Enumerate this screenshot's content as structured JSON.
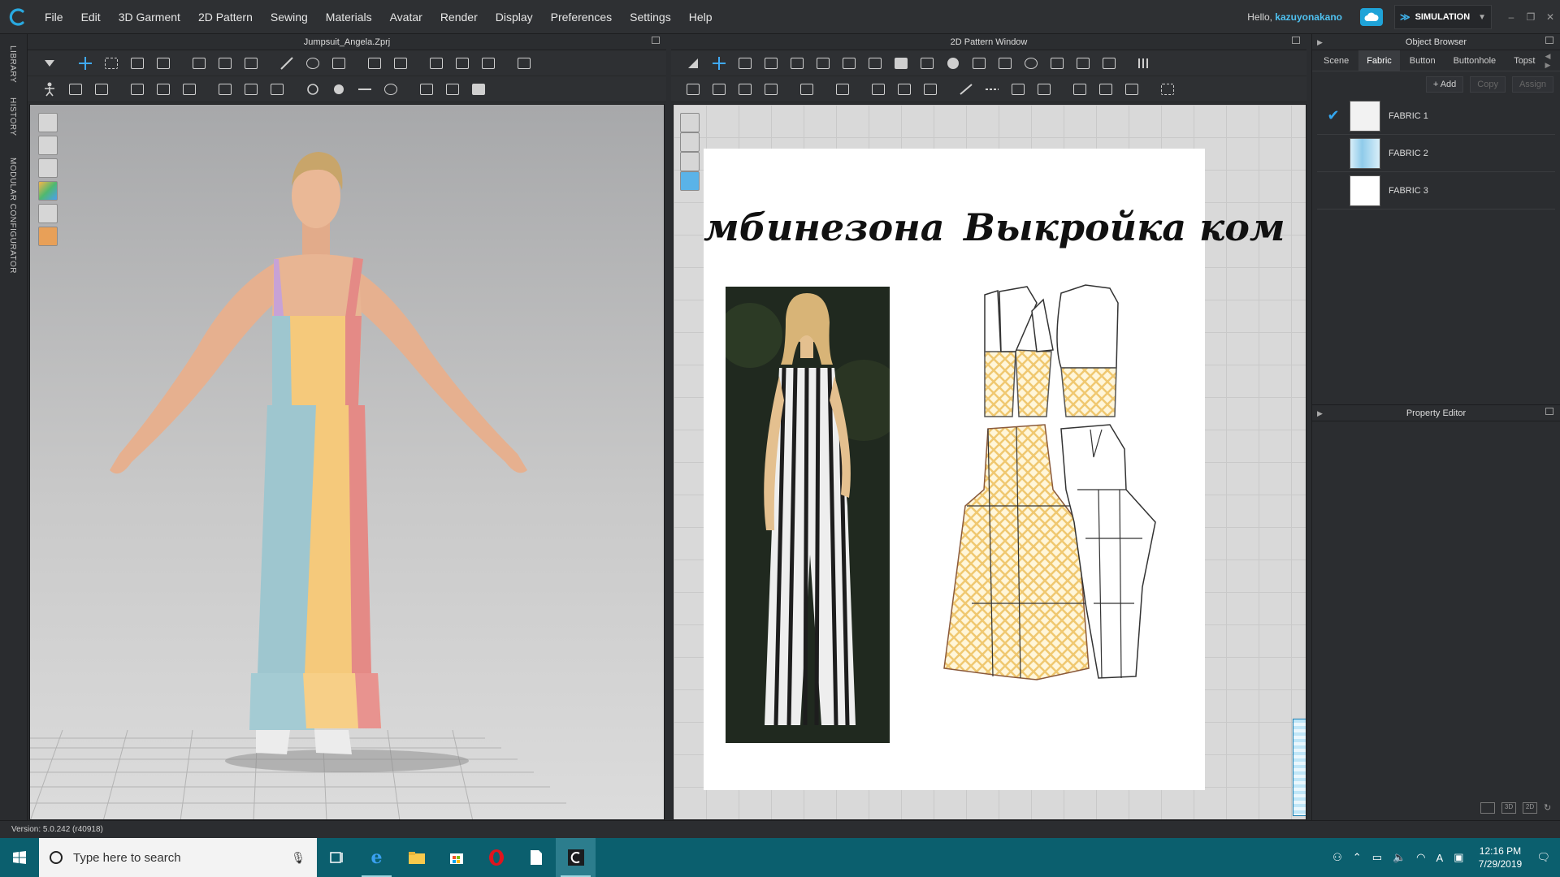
{
  "app": {
    "menu": [
      "File",
      "Edit",
      "3D Garment",
      "2D Pattern",
      "Sewing",
      "Materials",
      "Avatar",
      "Render",
      "Display",
      "Preferences",
      "Settings",
      "Help"
    ],
    "greeting": "Hello,",
    "username": "kazuyonakano",
    "mode": "SIMULATION",
    "left_tabs": [
      "LIBRARY",
      "HISTORY",
      "MODULAR CONFIGURATOR"
    ]
  },
  "window3d": {
    "title": "Jumpsuit_Angela.Zprj"
  },
  "window2d": {
    "title": "2D Pattern Window",
    "sheet_text_left": "мбинезона",
    "sheet_text_right": "Выкройка ком"
  },
  "object_browser": {
    "title": "Object Browser",
    "tabs": [
      "Scene",
      "Fabric",
      "Button",
      "Buttonhole",
      "Topst"
    ],
    "active_tab": "Fabric",
    "actions": {
      "add": "+ Add",
      "copy": "Copy",
      "assign": "Assign"
    },
    "fabrics": [
      {
        "label": "FABRIC 1",
        "checked": true,
        "swatch": "#f2f2f2"
      },
      {
        "label": "FABRIC 2",
        "checked": false,
        "swatch": "#a9d6ee"
      },
      {
        "label": "FABRIC 3",
        "checked": false,
        "swatch": "#ffffff"
      }
    ]
  },
  "property_editor": {
    "title": "Property Editor"
  },
  "status": {
    "version": "Version: 5.0.242 (r40918)"
  },
  "taskbar": {
    "search_placeholder": "Type here to search",
    "time": "12:16 PM",
    "date": "7/29/2019"
  },
  "colors": {
    "accent": "#34a6ee",
    "taskbar": "#0b5f6e",
    "garment_yellow": "#f5c97b",
    "garment_pink": "#e48a86",
    "garment_blue": "#9ec6cf"
  }
}
